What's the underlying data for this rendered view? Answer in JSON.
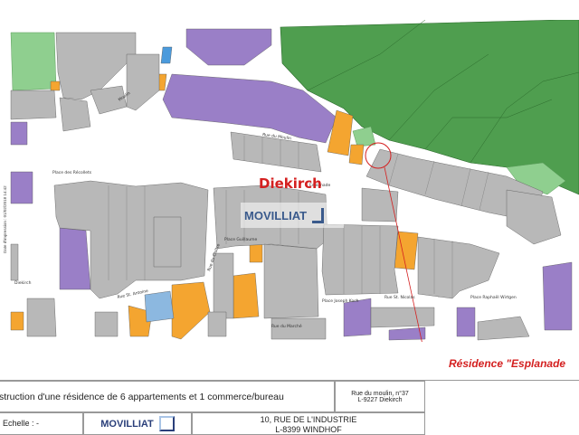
{
  "map": {
    "town_label": "Diekirch",
    "watermark": "MOVILLIAT",
    "credit": "Date d'impression : 01/02/2018 14:42",
    "streets": {
      "esplanade": "Esplanade",
      "moulin": "Rue du Moulin",
      "guillaume": "Place Guillaume",
      "recollets": "Place des Récollets",
      "st_antoine": "Rue St. Antoine",
      "kock": "Place Joseph Koch",
      "nicolas": "Rue St. Nicolas",
      "wirtgen": "Place Raphaël Wirtgen",
      "marche": "Rue du Marché",
      "cloitre": "Rue du Cloître",
      "moulin_short": "Moulin",
      "diekirch_left": "Diekirch"
    },
    "colors": {
      "vegetation": "#4f9e4f",
      "vegetation_light": "#8fcf8f",
      "public_building": "#9a7fc7",
      "commercial_building": "#f4a530",
      "residential_building": "#b8b8b8",
      "road": "#ffffff",
      "marker": "#d42020"
    }
  },
  "annotation": {
    "residence_label": "Résidence \"Esplanade"
  },
  "title_block": {
    "project_description": "struction d'une résidence de 6 appartements et 1 commerce/bureau",
    "site_address_line1": "Rue du moulin, n°37",
    "site_address_line2": "L-9227 Diekirch",
    "scale_label": "Echelle : -",
    "company_name": "MOVILLIAT",
    "company_address_line1": "10, RUE DE L'INDUSTRIE",
    "company_address_line2": "L-8399 WINDHOF"
  }
}
